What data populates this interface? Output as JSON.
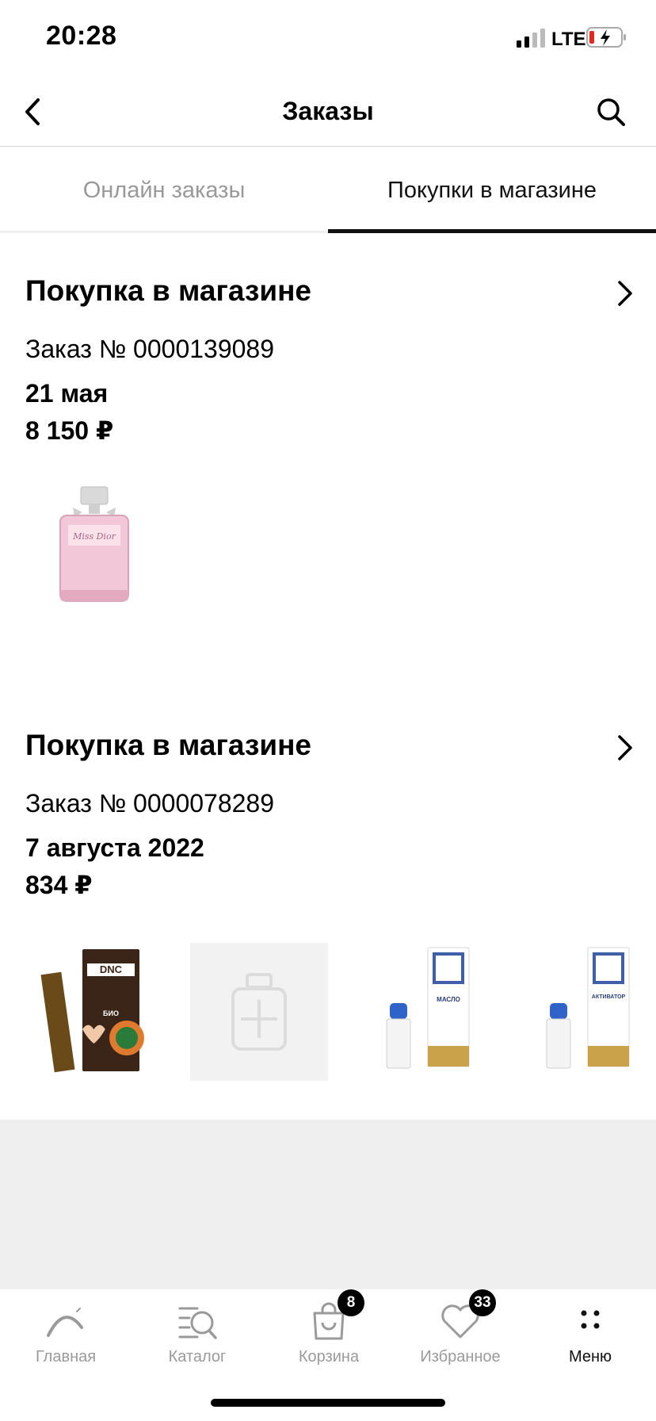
{
  "status_bar": {
    "time": "20:28",
    "network": "LTE"
  },
  "header": {
    "title": "Заказы"
  },
  "tabs": [
    {
      "label": "Онлайн заказы",
      "active": false
    },
    {
      "label": "Покупки в магазине",
      "active": true
    }
  ],
  "orders": [
    {
      "title": "Покупка в магазине",
      "number": "Заказ № 0000139089",
      "date": "21 мая",
      "sum": "8 150 ₽",
      "products": [
        {
          "icon": "perfume-bottle-pink",
          "label": "Miss Dior"
        }
      ]
    },
    {
      "title": "Покупка в магазине",
      "number": "Заказ № 0000078289",
      "date": "7 августа 2022",
      "sum": "834 ₽",
      "products": [
        {
          "icon": "hair-complex-box",
          "brand": "DNC",
          "label": "БИО КОМПЛЕКС ДЛЯ ВОЛОС"
        },
        {
          "icon": "product-placeholder"
        },
        {
          "icon": "oil-bottle-box",
          "label": "МАСЛО БЭЙ"
        },
        {
          "icon": "activator-bottle-box",
          "label": "АКТИВАТОР РОСТА ВОЛОС"
        }
      ]
    }
  ],
  "bottom_nav": [
    {
      "label": "Главная",
      "icon": "home-arc-icon",
      "active": false
    },
    {
      "label": "Каталог",
      "icon": "catalog-search-icon",
      "active": false
    },
    {
      "label": "Корзина",
      "icon": "cart-bag-icon",
      "badge": "8",
      "active": false
    },
    {
      "label": "Избранное",
      "icon": "heart-icon",
      "badge": "33",
      "active": false
    },
    {
      "label": "Меню",
      "icon": "menu-dots-icon",
      "active": true
    }
  ],
  "colors": {
    "accent": "#111111",
    "muted": "#9a9a9a",
    "divider": "#d4d4d4",
    "background_gray": "#efefef"
  }
}
